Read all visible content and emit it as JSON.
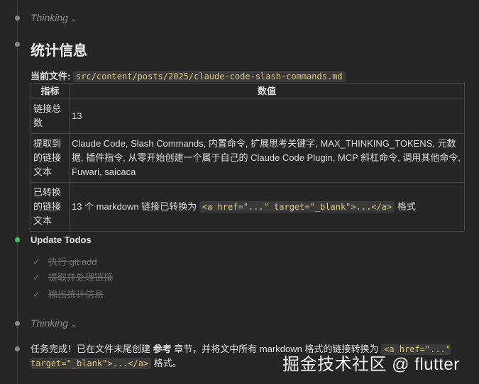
{
  "thinking_1": {
    "label": "Thinking"
  },
  "stats": {
    "heading": "统计信息",
    "file_label": "当前文件:",
    "file_path": "src/content/posts/2025/claude-code-slash-commands.md",
    "table": {
      "header_metric": "指标",
      "header_value": "数值",
      "rows": [
        {
          "metric": "链接总数",
          "value": "13"
        },
        {
          "metric": "提取到的链接文本",
          "value": "Claude Code, Slash Commands, 内置命令, 扩展思考关键字, MAX_THINKING_TOKENS, 元数据, 插件指令, 从零开始创建一个属于自己的 Claude Code Plugin, MCP 斜杠命令, 调用其他命令, Fuwari, saicaca"
        },
        {
          "metric": "已转换的链接文本",
          "value_prefix": "13 个 markdown 链接已转换为",
          "value_code": "<a href=\"...\" target=\"_blank\">...</a>",
          "value_suffix": "格式"
        }
      ]
    }
  },
  "todos": {
    "title": "Update Todos",
    "items": [
      {
        "label": "执行 git add",
        "done": true
      },
      {
        "label": "提取并处理链接",
        "done": true
      },
      {
        "label": "输出统计信息",
        "done": true
      }
    ]
  },
  "thinking_2": {
    "label": "Thinking"
  },
  "final": {
    "text_1": "任务完成！已在文件末尾创建",
    "bold_1": "参考",
    "text_2": "章节，并将文中所有 markdown 格式的链接转换为",
    "code": "<a href=\"...\" target=\"_blank\">...</a>",
    "text_3": "格式。"
  },
  "watermark": "掘金技术社区 @ flutter",
  "colors": {
    "background": "#262626",
    "active_dot": "#3ec46d",
    "code_text": "#e4c77e"
  }
}
